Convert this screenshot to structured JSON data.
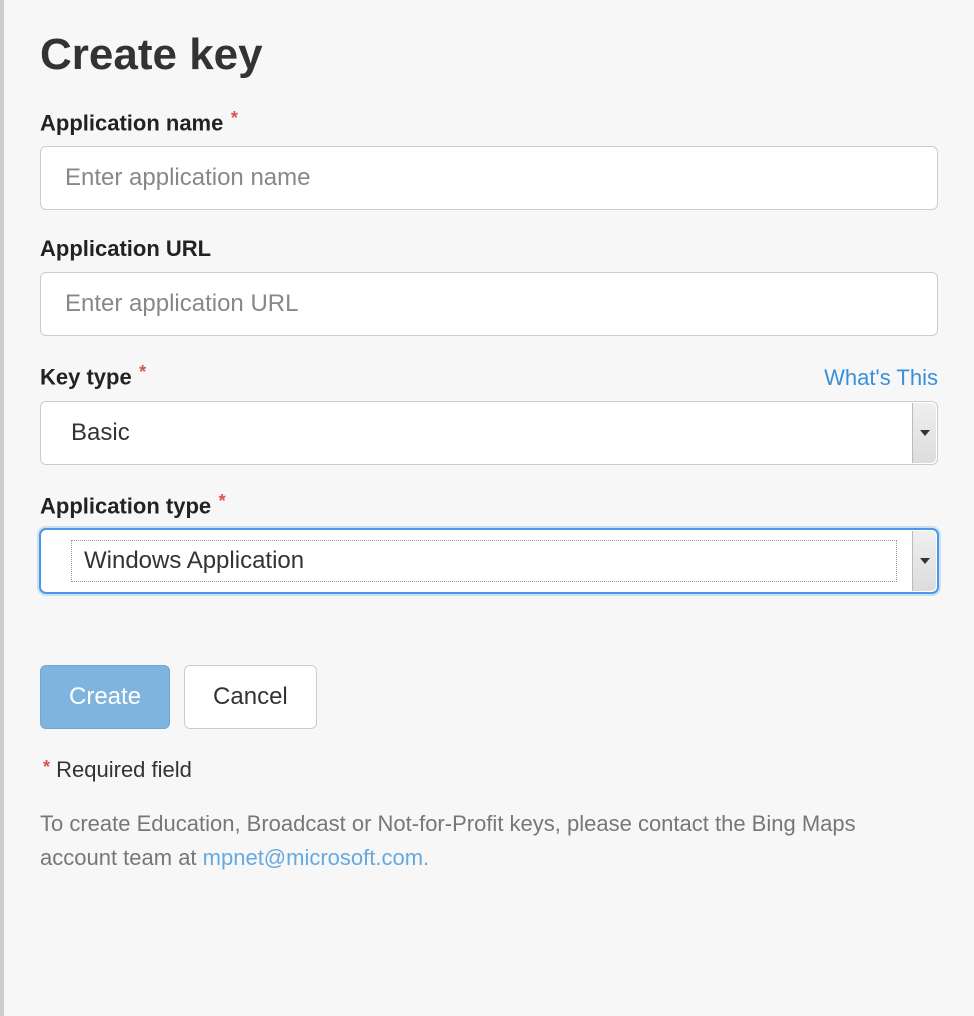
{
  "title": "Create key",
  "fields": {
    "app_name": {
      "label": "Application name",
      "placeholder": "Enter application name",
      "required": true
    },
    "app_url": {
      "label": "Application URL",
      "placeholder": "Enter application URL",
      "required": false
    },
    "key_type": {
      "label": "Key type",
      "value": "Basic",
      "required": true,
      "help_link": "What's This"
    },
    "app_type": {
      "label": "Application type",
      "value": "Windows Application",
      "required": true
    }
  },
  "required_marker": "*",
  "buttons": {
    "create": "Create",
    "cancel": "Cancel"
  },
  "required_note": "Required field",
  "info_prefix": "To create Education, Broadcast or Not-for-Profit keys, please contact the Bing Maps account team at ",
  "info_email": "mpnet@microsoft.com."
}
